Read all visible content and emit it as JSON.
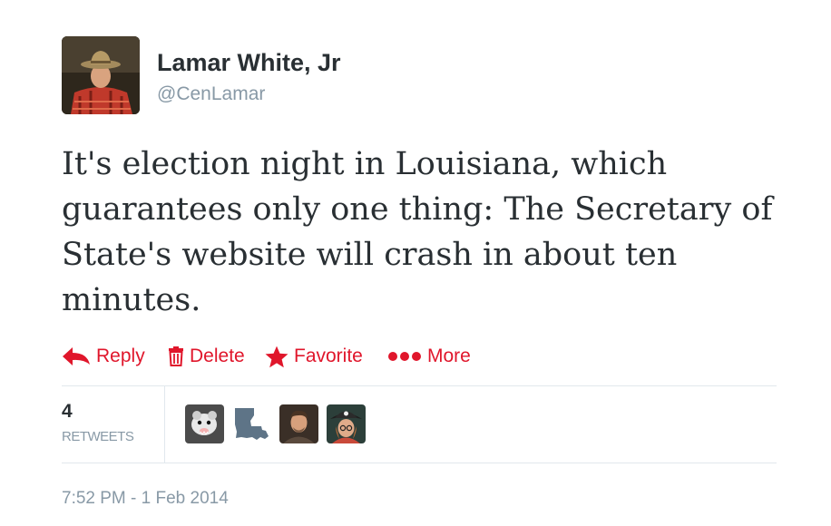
{
  "user": {
    "display_name": "Lamar White, Jr",
    "handle": "@CenLamar"
  },
  "tweet": {
    "text": "It's election night in Louisiana, which guarantees only one thing: The Secretary of State's website will crash in about ten minutes."
  },
  "actions": [
    {
      "label": "Reply",
      "icon": "reply-icon"
    },
    {
      "label": "Delete",
      "icon": "trash-icon"
    },
    {
      "label": "Favorite",
      "icon": "star-icon"
    },
    {
      "label": "More",
      "icon": "more-dots-icon"
    }
  ],
  "stats": {
    "retweet_count": "4",
    "retweet_label": "RETWEETS"
  },
  "retweeters": [
    {
      "icon": "opossum-avatar"
    },
    {
      "icon": "louisiana-map-avatar"
    },
    {
      "icon": "man-portrait-avatar"
    },
    {
      "icon": "pirate-hat-avatar"
    }
  ],
  "timestamp": "7:52 PM - 1 Feb 2014",
  "colors": {
    "action_red": "#e0162b",
    "text_dark": "#292f33",
    "text_muted": "#8899a6",
    "divider": "#e1e8ed"
  }
}
